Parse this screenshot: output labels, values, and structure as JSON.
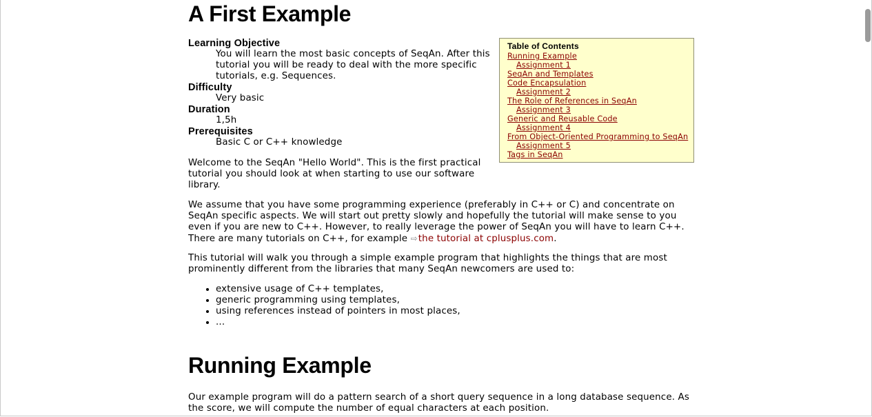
{
  "page": {
    "title": "A First Example",
    "section_title": "Running Example"
  },
  "meta": {
    "learning_objective_label": "Learning Objective",
    "learning_objective_text": "You will learn the most basic concepts of SeqAn. After this tutorial you will be ready to deal with the more specific tutorials, e.g. Sequences.",
    "difficulty_label": "Difficulty",
    "difficulty_text": "Very basic",
    "duration_label": "Duration",
    "duration_text": "1,5h",
    "prerequisites_label": "Prerequisites",
    "prerequisites_text": "Basic C or C++ knowledge"
  },
  "toc": {
    "title": "Table of Contents",
    "items": [
      {
        "label": "Running Example",
        "level": 0
      },
      {
        "label": "Assignment 1",
        "level": 1
      },
      {
        "label": "SeqAn and Templates",
        "level": 0
      },
      {
        "label": "Code Encapsulation",
        "level": 0
      },
      {
        "label": "Assignment 2",
        "level": 1
      },
      {
        "label": "The Role of References in SeqAn",
        "level": 0
      },
      {
        "label": "Assignment 3",
        "level": 1
      },
      {
        "label": "Generic and Reusable Code",
        "level": 0
      },
      {
        "label": "Assignment 4",
        "level": 1
      },
      {
        "label": "From Object-Oriented Programming to SeqAn",
        "level": 0
      },
      {
        "label": "Assignment 5",
        "level": 1
      },
      {
        "label": "Tags in SeqAn",
        "level": 0
      }
    ]
  },
  "body": {
    "intro": "Welcome to the SeqAn \"Hello World\". This is the first practical tutorial you should look at when starting to use our software library.",
    "assume_text": "We assume that you have some programming experience (preferably in C++ or C) and concentrate on SeqAn specific aspects. We will start out pretty slowly and hopefully the tutorial will make sense to you even if you are new to C++. However, to really leverage the power of SeqAn you will have to learn C++. There are many tutorials on C++, for example ",
    "link_text": "the tutorial at cplusplus.com",
    "link_after": ".",
    "walk_text": "This tutorial will walk you through a simple example program that highlights the things that are most prominently different from the libraries that many SeqAn newcomers are used to:",
    "features": [
      "extensive usage of C++ templates,",
      "generic programming using templates,",
      "using references instead of pointers in most places,",
      "..."
    ],
    "running_text": "Our example program will do a pattern search of a short query sequence in a long database sequence. As the score, we will compute the number of equal characters at each position."
  },
  "icons": {
    "external_link": "external-link-icon"
  }
}
